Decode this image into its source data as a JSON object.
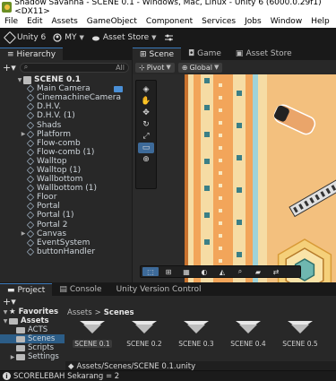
{
  "window": {
    "title": "Shadow Savanna - SCENE 0.1 - Windows, Mac, Linux - Unity 6 (6000.0.29f1) <DX11>"
  },
  "menu": [
    "File",
    "Edit",
    "Assets",
    "GameObject",
    "Component",
    "Services",
    "Jobs",
    "Window",
    "Help"
  ],
  "toolbar": {
    "unity_label": "Unity 6",
    "account_label": "MY",
    "asset_store_label": "Asset Store"
  },
  "hierarchy": {
    "tab_label": "Hierarchy",
    "search_placeholder": "All",
    "scene_name": "SCENE 0.1",
    "items": [
      {
        "label": "Main Camera",
        "expandable": false
      },
      {
        "label": "CinemachineCamera",
        "expandable": false
      },
      {
        "label": "D.H.V.",
        "expandable": false
      },
      {
        "label": "D.H.V. (1)",
        "expandable": false
      },
      {
        "label": "Shads",
        "expandable": false
      },
      {
        "label": "Platform",
        "expandable": true
      },
      {
        "label": "Flow-comb",
        "expandable": false
      },
      {
        "label": "Flow-comb (1)",
        "expandable": false
      },
      {
        "label": "Walltop",
        "expandable": false
      },
      {
        "label": "Walltop (1)",
        "expandable": false
      },
      {
        "label": "Wallbottom",
        "expandable": false
      },
      {
        "label": "Wallbottom (1)",
        "expandable": false
      },
      {
        "label": "Floor",
        "expandable": false
      },
      {
        "label": "Portal",
        "expandable": false
      },
      {
        "label": "Portal (1)",
        "expandable": false
      },
      {
        "label": "Portal 2",
        "expandable": false
      },
      {
        "label": "Canvas",
        "expandable": true
      },
      {
        "label": "EventSystem",
        "expandable": false
      },
      {
        "label": "buttonHandler",
        "expandable": false
      }
    ]
  },
  "scene_view": {
    "tabs": [
      "Scene",
      "Game",
      "Asset Store"
    ],
    "pivot_label": "Pivot",
    "global_label": "Global",
    "left_tools": [
      "view",
      "hand",
      "move",
      "rotate",
      "scale",
      "rect",
      "transform"
    ],
    "bottom_tools": [
      "grid-select",
      "grid-snap",
      "grid-paint",
      "circle",
      "bucket",
      "search",
      "eraser",
      "swap"
    ]
  },
  "project": {
    "tabs": [
      "Project",
      "Console",
      "Unity Version Control"
    ],
    "tree": [
      {
        "label": "Favorites",
        "level": 0,
        "bold": true,
        "expanded": true
      },
      {
        "label": "Assets",
        "level": 0,
        "bold": true,
        "expanded": true
      },
      {
        "label": "ACTS",
        "level": 1
      },
      {
        "label": "Scenes",
        "level": 1,
        "selected": true
      },
      {
        "label": "Scripts",
        "level": 1
      },
      {
        "label": "Settings",
        "level": 1,
        "collapsed": true
      }
    ],
    "breadcrumb": {
      "root": "Assets",
      "separator": ">",
      "current": "Scenes"
    },
    "assets": [
      "SCENE 0.1",
      "SCENE 0.2",
      "SCENE 0.3",
      "SCENE 0.4",
      "SCENE 0.5"
    ],
    "selected_asset": "SCENE 0.1",
    "path": "Assets/Scenes/SCENE 0.1.unity"
  },
  "status": {
    "message": "SCORELEBAH Sekarang = 2"
  },
  "colors": {
    "accent": "#3a79bb",
    "selection": "#2c5d87",
    "panel": "#282828",
    "tile_orange": "#f2a55a",
    "tile_cream": "#f6dca4",
    "tile_teal": "#3b7f86"
  }
}
